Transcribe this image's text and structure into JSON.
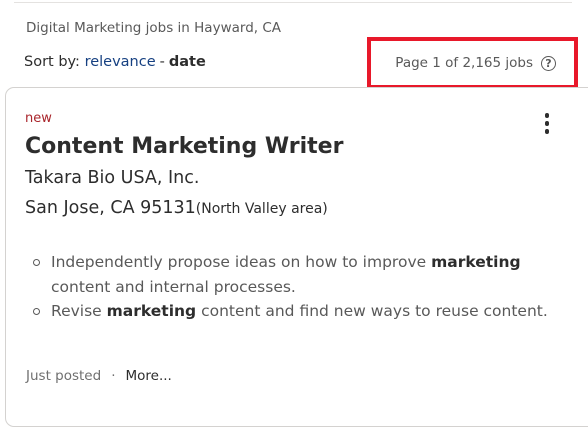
{
  "search_summary": "Digital Marketing jobs in Hayward, CA",
  "sort": {
    "label": "Sort by:",
    "relevance": "relevance",
    "separator": "-",
    "date": "date"
  },
  "pagination": {
    "text": "Page 1 of 2,165 jobs",
    "help_icon": "help-circle-icon"
  },
  "job": {
    "badge": "new",
    "title": "Content Marketing Writer",
    "company": "Takara Bio USA, Inc.",
    "location": "San Jose, CA 95131",
    "area": "(North Valley area)",
    "snippet": [
      {
        "before": "Independently propose ideas on how to improve ",
        "highlight": "marketing",
        "after": " content and internal processes."
      },
      {
        "before": "Revise ",
        "highlight": "marketing",
        "after": " content and find new ways to reuse content."
      }
    ],
    "posted": "Just posted",
    "dot": "·",
    "more_link": "More..."
  },
  "colors": {
    "highlight_box": "#e8182a",
    "link": "#164081",
    "badge": "#a9252b"
  }
}
